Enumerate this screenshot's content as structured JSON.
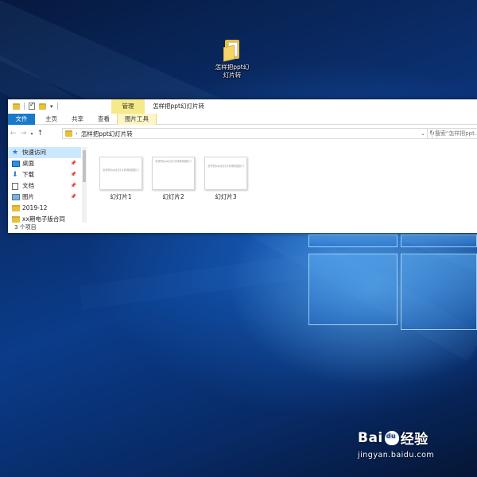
{
  "desktop": {
    "icon_label_line1": "怎样把ppt幻",
    "icon_label_line2": "灯片转"
  },
  "window": {
    "title": "怎样把ppt幻灯片转",
    "manage_tab": "管理",
    "ribbon_tabs": [
      "文件",
      "主页",
      "共享",
      "查看",
      "图片工具"
    ],
    "address_path": "怎样把ppt幻灯片转",
    "search_placeholder": "搜索\"怎样把ppt..."
  },
  "nav_pane": {
    "items": [
      {
        "label": "快速访问",
        "icon": "star-icon",
        "pinned": false
      },
      {
        "label": "桌面",
        "icon": "desktop-icon",
        "pinned": true
      },
      {
        "label": "下载",
        "icon": "download-icon",
        "pinned": true
      },
      {
        "label": "文档",
        "icon": "document-icon",
        "pinned": true
      },
      {
        "label": "图片",
        "icon": "pictures-icon",
        "pinned": true
      },
      {
        "label": "2019-12",
        "icon": "folder-icon",
        "pinned": false
      },
      {
        "label": "xx期电子版合同",
        "icon": "folder-icon",
        "pinned": false
      }
    ]
  },
  "files": [
    {
      "name": "幻灯片1",
      "preview": "怎样把ppt幻灯片转换成图片？"
    },
    {
      "name": "幻灯片2",
      "preview": "怎样把ppt幻灯片转换成图片？"
    },
    {
      "name": "幻灯片3",
      "preview": "怎样把ppt幻灯片转换成图片？"
    }
  ],
  "status": {
    "item_count": "3 个项目"
  },
  "watermark": {
    "logo_left": "Bai",
    "logo_right": "经验",
    "url": "jingyan.baidu.com"
  }
}
